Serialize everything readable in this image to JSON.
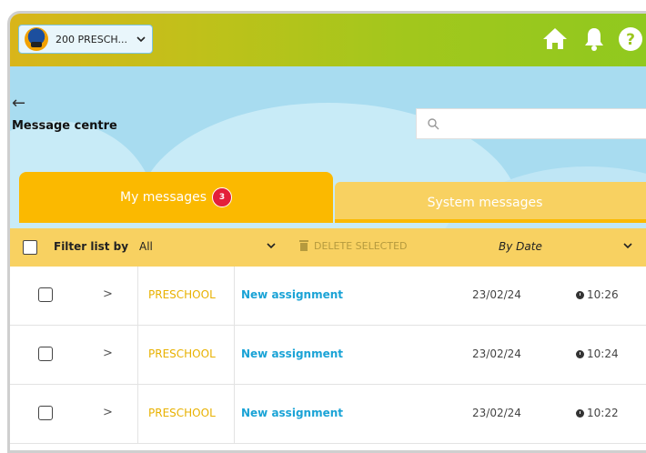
{
  "header": {
    "school_selector": "200 PRESCH...",
    "selector_chevron": "⌄"
  },
  "page": {
    "back_arrow": "←",
    "title": "Message centre",
    "search_placeholder": ""
  },
  "tabs": [
    {
      "label": "My messages",
      "badge": "3",
      "active": true
    },
    {
      "label": "System messages",
      "active": false
    }
  ],
  "filter": {
    "label": "Filter list by",
    "value": "All",
    "delete_label": "DELETE SELECTED",
    "sort_label": "By Date"
  },
  "messages": [
    {
      "school": "PRESCHOOL",
      "subject": "New assignment",
      "date": "23/02/24",
      "time": "10:26"
    },
    {
      "school": "PRESCHOOL",
      "subject": "New assignment",
      "date": "23/02/24",
      "time": "10:24"
    },
    {
      "school": "PRESCHOOL",
      "subject": "New assignment",
      "date": "23/02/24",
      "time": "10:22"
    }
  ],
  "colors": {
    "accent_yellow": "#fbb900",
    "link_blue": "#1aa3d6",
    "badge_red": "#e3203a",
    "sky_blue": "#a8dcf0"
  }
}
